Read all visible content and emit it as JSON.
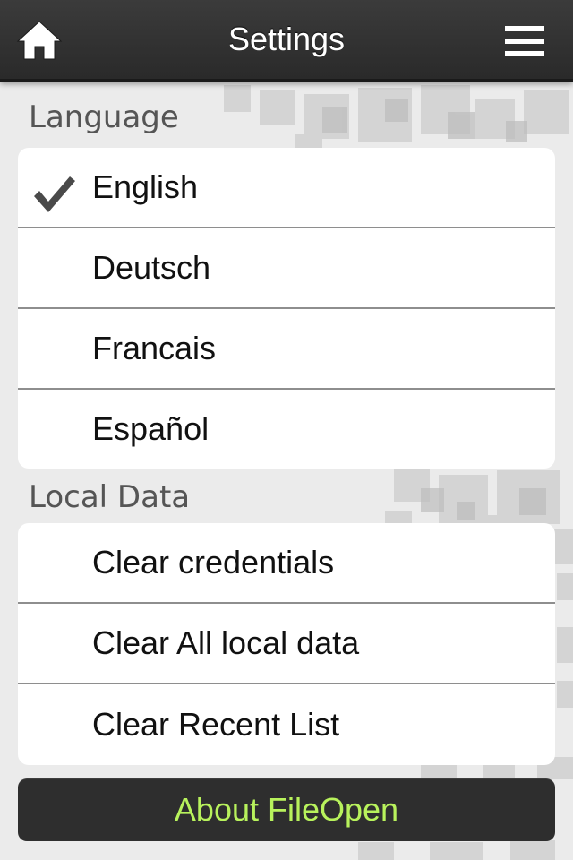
{
  "nav": {
    "title": "Settings",
    "home_icon": "home-icon",
    "menu_icon": "hamburger-menu-icon"
  },
  "language": {
    "header": "Language",
    "items": [
      {
        "label": "English",
        "selected": true
      },
      {
        "label": "Deutsch",
        "selected": false
      },
      {
        "label": "Francais",
        "selected": false
      },
      {
        "label": "Español",
        "selected": false
      }
    ]
  },
  "local_data": {
    "header": "Local Data",
    "items": [
      {
        "label": "Clear credentials"
      },
      {
        "label": "Clear All local data"
      },
      {
        "label": "Clear Recent List"
      }
    ]
  },
  "about": {
    "label": "About FileOpen"
  },
  "colors": {
    "nav_background": "#2e2e2e",
    "accent_text": "#b8f25c",
    "page_background": "#ebebeb"
  }
}
